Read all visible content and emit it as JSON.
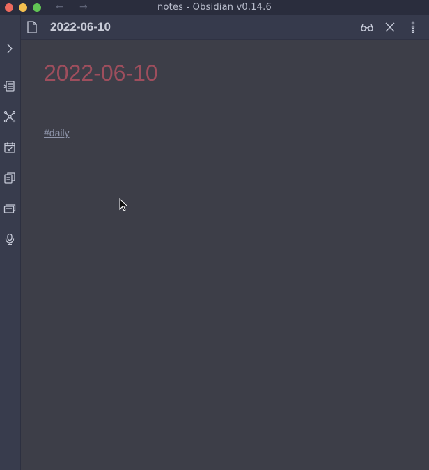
{
  "window": {
    "title": "notes - Obsidian v0.14.6",
    "back_arrow": "←",
    "forward_arrow": "→"
  },
  "ribbon": {
    "items": [
      {
        "icon": "chevron-right-icon"
      },
      {
        "icon": "quick-switcher-icon"
      },
      {
        "icon": "graph-view-icon"
      },
      {
        "icon": "daily-note-calendar-icon"
      },
      {
        "icon": "templates-icon"
      },
      {
        "icon": "slides-icon"
      },
      {
        "icon": "microphone-icon"
      }
    ]
  },
  "tab": {
    "title": "2022-06-10",
    "file_icon": "file-icon",
    "actions": [
      "reading-view-icon",
      "close-icon",
      "more-options-icon"
    ]
  },
  "note": {
    "heading": "2022-06-10",
    "tag": "#daily"
  },
  "colors": {
    "heading": "#9e4e5d",
    "background": "#3d3e48",
    "ribbon": "#383c4d"
  }
}
